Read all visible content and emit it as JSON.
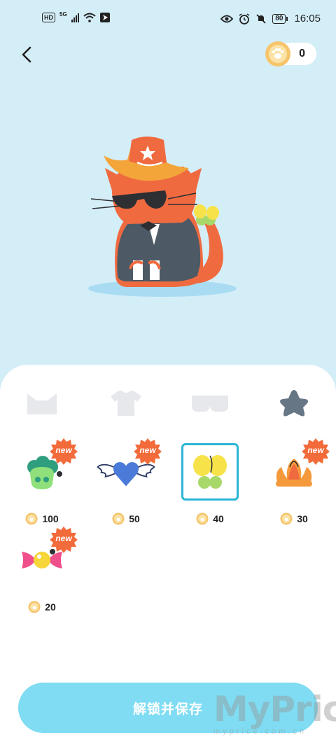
{
  "status_bar": {
    "left_badges": [
      "HD",
      "5G"
    ],
    "battery": "80",
    "time": "16:05"
  },
  "header": {
    "coin_count": "0"
  },
  "category_tabs": [
    {
      "icon": "cat-ears-icon",
      "selected": false
    },
    {
      "icon": "tshirt-icon",
      "selected": false
    },
    {
      "icon": "glasses-icon",
      "selected": false
    },
    {
      "icon": "star-icon",
      "selected": true
    }
  ],
  "items": [
    {
      "icon": "green-flower-hairpin-icon",
      "price": "100",
      "new_label": "new",
      "selected": false
    },
    {
      "icon": "winged-heart-icon",
      "price": "50",
      "new_label": "new",
      "selected": false
    },
    {
      "icon": "yellow-bow-icon",
      "price": "40",
      "new_label": "",
      "selected": true
    },
    {
      "icon": "orange-shell-icon",
      "price": "30",
      "new_label": "new",
      "selected": false
    },
    {
      "icon": "candy-bow-icon",
      "price": "20",
      "new_label": "new",
      "selected": false
    }
  ],
  "cta_label": "解锁并保存",
  "watermark": {
    "brand": "MyPrice",
    "url": "myprice.com.cn"
  },
  "colors": {
    "background": "#d4eef8",
    "accent": "#2ab5d6",
    "cta": "#7fdcf2",
    "new_badge": "#f26b3a"
  }
}
